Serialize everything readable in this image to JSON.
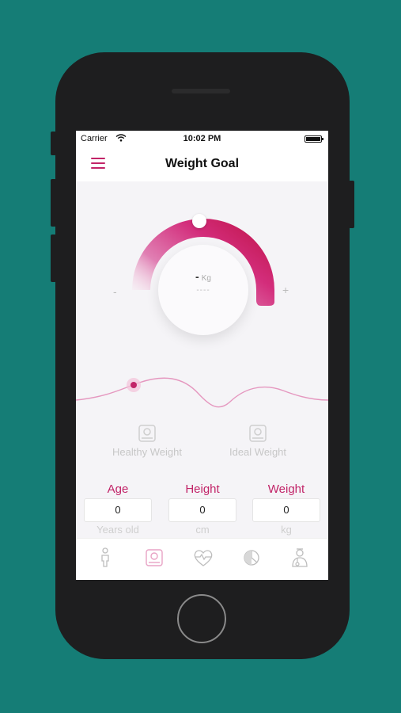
{
  "status_bar": {
    "carrier": "Carrier",
    "time": "10:02 PM"
  },
  "nav": {
    "title": "Weight Goal"
  },
  "dial": {
    "value": "-",
    "unit": "Kg",
    "placeholder": "----",
    "minus": "-",
    "plus": "+"
  },
  "modes": [
    {
      "label": "Healthy Weight",
      "icon": "scale-icon"
    },
    {
      "label": "Ideal Weight",
      "icon": "scale-icon"
    }
  ],
  "fields": [
    {
      "label": "Age",
      "value": "0",
      "unit": "Years old"
    },
    {
      "label": "Height",
      "value": "0",
      "unit": "cm"
    },
    {
      "label": "Weight",
      "value": "0",
      "unit": "kg"
    }
  ],
  "tabs": [
    {
      "icon": "person-icon",
      "active": false
    },
    {
      "icon": "scale-icon",
      "active": true
    },
    {
      "icon": "heartbeat-icon",
      "active": false
    },
    {
      "icon": "pie-chart-icon",
      "active": false
    },
    {
      "icon": "doctor-icon",
      "active": false
    }
  ],
  "colors": {
    "accent": "#c22468",
    "background": "#157d76",
    "screen_bg": "#f5f4f7"
  }
}
